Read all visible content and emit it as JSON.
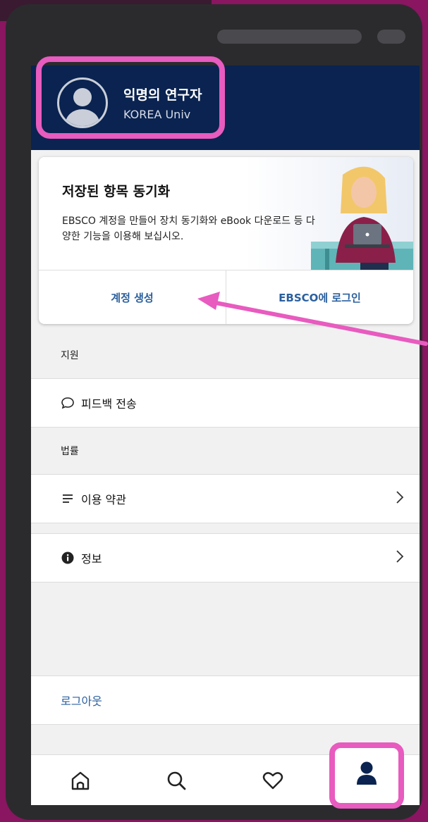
{
  "profile": {
    "name": "익명의 연구자",
    "org": "KOREA Univ"
  },
  "sync_card": {
    "title": "저장된 항목 동기화",
    "description": "EBSCO 계정을 만들어 장치 동기화와 eBook 다운로드 등 다양한 기능을 이용해 보십시오.",
    "create_account_label": "계정 생성",
    "login_label": "EBSCO에 로그인"
  },
  "sections": {
    "support_label": "지원",
    "feedback_label": "피드백 전송",
    "legal_label": "법률",
    "terms_label": "이용 약관",
    "info_label": "정보",
    "logout_label": "로그아웃"
  },
  "tabbar": {
    "items": [
      {
        "icon": "home-icon"
      },
      {
        "icon": "search-icon"
      },
      {
        "icon": "heart-icon"
      },
      {
        "icon": "profile-icon",
        "active": true
      }
    ]
  },
  "colors": {
    "header": "#0a2350",
    "accent_link": "#2a5f9e",
    "highlight": "#e85bbf"
  }
}
